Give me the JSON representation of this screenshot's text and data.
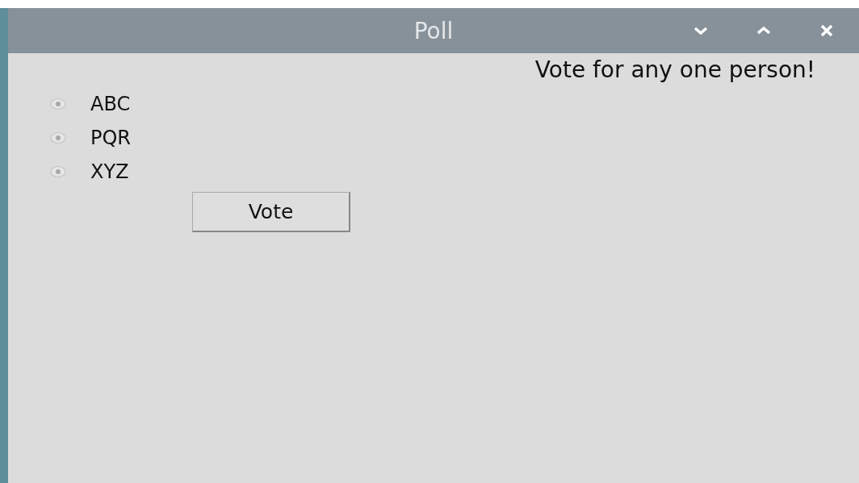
{
  "window": {
    "title": "Poll"
  },
  "heading": "Vote for any one person!",
  "options": [
    {
      "label": "ABC",
      "selected": false
    },
    {
      "label": "PQR",
      "selected": false
    },
    {
      "label": "XYZ",
      "selected": false
    }
  ],
  "button": "Vote"
}
